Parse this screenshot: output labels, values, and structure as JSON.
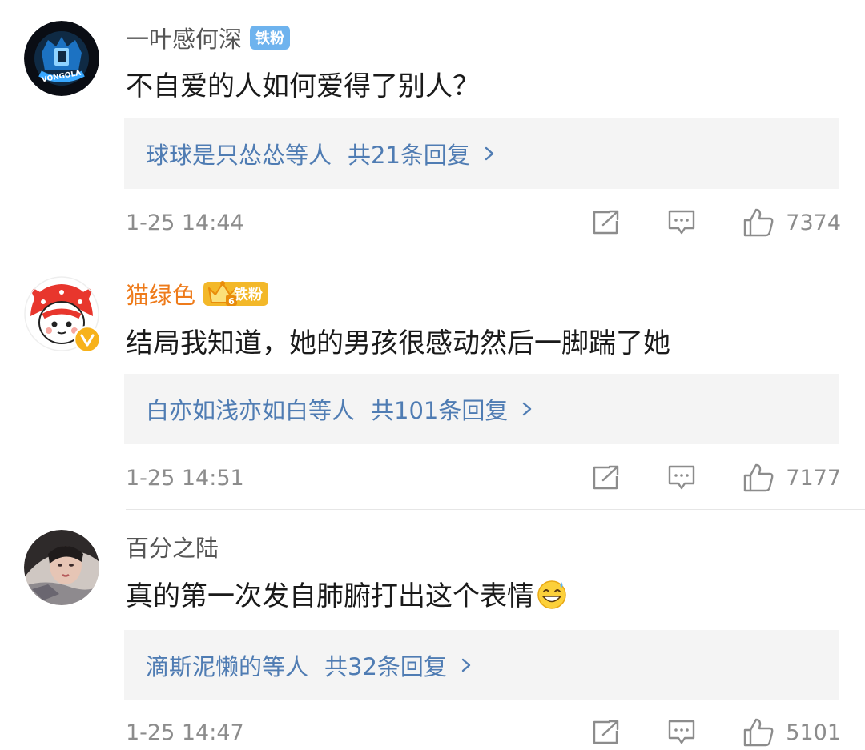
{
  "comments": [
    {
      "username": "一叶感何深",
      "badge": "铁粉",
      "text": "不自爱的人如何爱得了别人？",
      "replies_by": "球球是只怂怂等人",
      "replies_total": "共21条回复",
      "time": "1-25 14:44",
      "likes": "7374",
      "avatar_logo_text": "VONGOLA"
    },
    {
      "username": "猫绿色",
      "badge": "铁粉",
      "badge_level": "6",
      "text": "结局我知道，她的男孩很感动然后一脚踹了她",
      "replies_by": "白亦如浅亦如白等人",
      "replies_total": "共101条回复",
      "time": "1-25 14:51",
      "likes": "7177"
    },
    {
      "username": "百分之陆",
      "text": "真的第一次发自肺腑打出这个表情",
      "replies_by": "滴斯泥懒的等人",
      "replies_total": "共32条回复",
      "time": "1-25 14:47",
      "likes": "5101"
    }
  ],
  "colors": {
    "reply_link": "#4f7cb3",
    "badge_blue": "#6eb3ee",
    "badge_gold": "#f3b829",
    "vip_name": "#ee7b1b",
    "meta_gray": "#8c8c8c"
  }
}
